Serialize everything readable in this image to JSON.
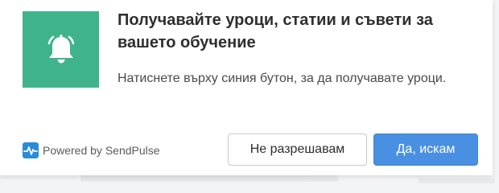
{
  "prompt": {
    "headline": "Получавайте уроци, статии и съвети за вашето обучение",
    "body": "Натиснете върху синия бутон, за да получавате уроци.",
    "powered_by": "Powered by SendPulse",
    "deny_label": "Не разрешавам",
    "allow_label": "Да, искам",
    "bell_icon": "bell-icon",
    "logo_icon": "sendpulse-logo-icon"
  },
  "colors": {
    "icon_background": "#3fb48c",
    "allow_button": "#4a90e2",
    "headline_text": "#2f2f2f"
  }
}
